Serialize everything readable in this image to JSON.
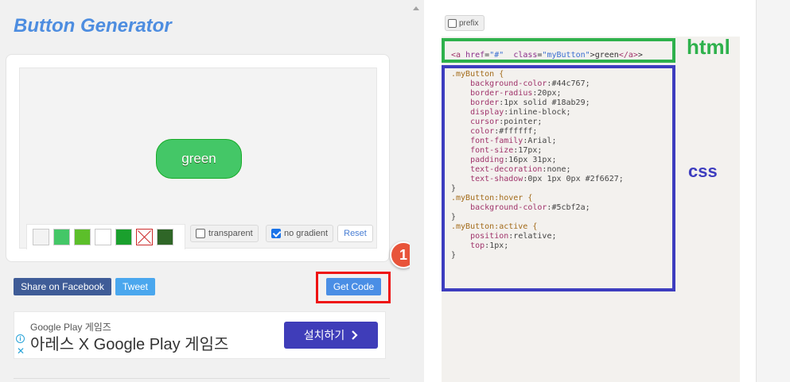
{
  "app": {
    "title": "Button Generator"
  },
  "preview": {
    "button_text": "green"
  },
  "swatches": [
    {
      "name": "light-gray",
      "color": "#f3f3f3"
    },
    {
      "name": "green",
      "color": "#44c767"
    },
    {
      "name": "lime",
      "color": "#5cbf2a"
    },
    {
      "name": "white",
      "color": "#ffffff"
    },
    {
      "name": "dark-green",
      "color": "#1aa02d"
    },
    {
      "name": "none",
      "color": "transparent"
    },
    {
      "name": "forest",
      "color": "#2f6627"
    }
  ],
  "options": {
    "transparent_label": "transparent",
    "transparent_checked": false,
    "no_gradient_label": "no gradient",
    "no_gradient_checked": true,
    "reset_label": "Reset"
  },
  "actions": {
    "facebook_label": "Share on Facebook",
    "tweet_label": "Tweet",
    "get_code_label": "Get Code",
    "step_badge": "1"
  },
  "ad": {
    "small_text": "Google Play 게임즈",
    "big_text": "아레스 X Google Play 게임즈",
    "button_label": "설치하기",
    "info_icon": "i",
    "close_icon": "✕"
  },
  "code_panel": {
    "prefix_label": "prefix",
    "html_label": "html",
    "css_label": "css",
    "html": {
      "open": "<a",
      "href_attr": "href",
      "href_val": "\"#\"",
      "class_attr": "class",
      "class_val": "\"myButton\"",
      "text": "green",
      "close": "</a>"
    },
    "css_lines": [
      {
        "kind": "sel",
        "text": ".myButton {"
      },
      {
        "kind": "decl",
        "prop": "background-color",
        "value": "#44c767;"
      },
      {
        "kind": "decl",
        "prop": "border-radius",
        "value": "20px;"
      },
      {
        "kind": "decl",
        "prop": "border",
        "value": "1px solid #18ab29;"
      },
      {
        "kind": "decl",
        "prop": "display",
        "value": "inline-block;"
      },
      {
        "kind": "decl",
        "prop": "cursor",
        "value": "pointer;"
      },
      {
        "kind": "decl",
        "prop": "color",
        "value": "#ffffff;"
      },
      {
        "kind": "decl",
        "prop": "font-family",
        "value": "Arial;"
      },
      {
        "kind": "decl",
        "prop": "font-size",
        "value": "17px;"
      },
      {
        "kind": "decl",
        "prop": "padding",
        "value": "16px 31px;"
      },
      {
        "kind": "decl",
        "prop": "text-decoration",
        "value": "none;"
      },
      {
        "kind": "decl",
        "prop": "text-shadow",
        "value": "0px 1px 0px #2f6627;"
      },
      {
        "kind": "close",
        "text": "}"
      },
      {
        "kind": "sel",
        "text": ".myButton:hover {"
      },
      {
        "kind": "decl",
        "prop": "background-color",
        "value": "#5cbf2a;"
      },
      {
        "kind": "close",
        "text": "}"
      },
      {
        "kind": "sel",
        "text": ".myButton:active {"
      },
      {
        "kind": "decl",
        "prop": "position",
        "value": "relative;"
      },
      {
        "kind": "decl",
        "prop": "top",
        "value": "1px;"
      },
      {
        "kind": "close",
        "text": "}"
      }
    ]
  },
  "colors": {
    "accent": "#4a8ee5",
    "highlight_red": "#ee1313",
    "html_frame": "#2eb14c",
    "css_frame": "#3d3dbf"
  }
}
